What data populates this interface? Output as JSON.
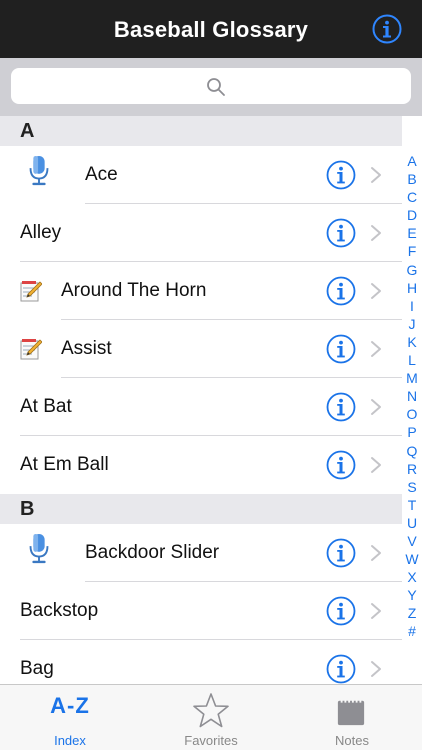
{
  "app": {
    "title": "Baseball Glossary"
  },
  "search": {
    "placeholder": ""
  },
  "list": {
    "sections": [
      {
        "letter": "A",
        "rows": [
          {
            "label": "Ace",
            "icon": "microphone-icon"
          },
          {
            "label": "Alley",
            "icon": ""
          },
          {
            "label": "Around The Horn",
            "icon": "note-icon"
          },
          {
            "label": "Assist",
            "icon": "note-icon"
          },
          {
            "label": "At Bat",
            "icon": ""
          },
          {
            "label": "At Em Ball",
            "icon": ""
          }
        ]
      },
      {
        "letter": "B",
        "rows": [
          {
            "label": "Backdoor Slider",
            "icon": "microphone-icon"
          },
          {
            "label": "Backstop",
            "icon": ""
          },
          {
            "label": "Bag",
            "icon": ""
          }
        ]
      }
    ]
  },
  "index_letters": [
    "A",
    "B",
    "C",
    "D",
    "E",
    "F",
    "G",
    "H",
    "I",
    "J",
    "K",
    "L",
    "M",
    "N",
    "O",
    "P",
    "Q",
    "R",
    "S",
    "T",
    "U",
    "V",
    "W",
    "X",
    "Y",
    "Z",
    "#"
  ],
  "tabs": [
    {
      "label": "Index",
      "icon": "az-icon",
      "glyph": "A-Z",
      "active": true
    },
    {
      "label": "Favorites",
      "icon": "star-icon",
      "active": false
    },
    {
      "label": "Notes",
      "icon": "notepad-icon",
      "active": false
    }
  ],
  "colors": {
    "accent": "#1a73e8",
    "navbar": "#202020",
    "section_header": "#e8e8ec",
    "search_bg": "#cfcfd4"
  }
}
